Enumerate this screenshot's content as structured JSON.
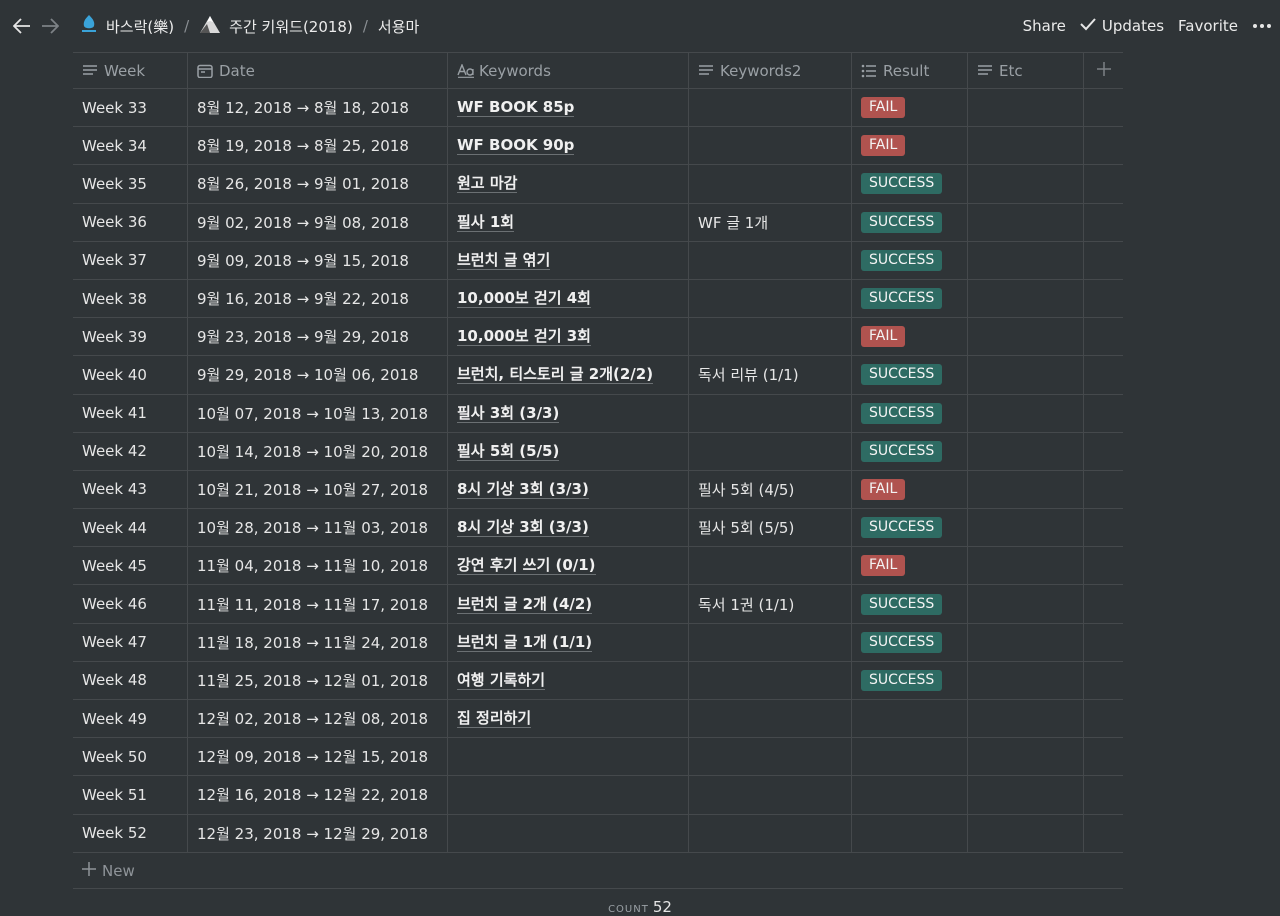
{
  "breadcrumb": [
    "바스락(樂)",
    "주간 키워드(2018)",
    "서용마"
  ],
  "top_actions": {
    "share": "Share",
    "updates": "Updates",
    "favorite": "Favorite"
  },
  "columns": [
    "Week",
    "Date",
    "Keywords",
    "Keywords2",
    "Result",
    "Etc"
  ],
  "column_icons": [
    "text-icon",
    "calendar-icon",
    "title-icon",
    "text-icon",
    "list-icon",
    "text-icon"
  ],
  "rows": [
    {
      "week": "Week 33",
      "date": "8월 12, 2018 → 8월 18, 2018",
      "kw": "WF BOOK 85p",
      "kw2": "",
      "result": "FAIL"
    },
    {
      "week": "Week 34",
      "date": "8월 19, 2018 → 8월 25, 2018",
      "kw": "WF BOOK 90p",
      "kw2": "",
      "result": "FAIL"
    },
    {
      "week": "Week 35",
      "date": "8월 26, 2018 → 9월 01, 2018",
      "kw": "원고 마감",
      "kw2": "",
      "result": "SUCCESS"
    },
    {
      "week": "Week 36",
      "date": "9월 02, 2018 → 9월 08, 2018",
      "kw": "필사 1회",
      "kw2": "WF 글 1개",
      "result": "SUCCESS"
    },
    {
      "week": "Week 37",
      "date": "9월 09, 2018 → 9월 15, 2018",
      "kw": "브런치 글 엮기",
      "kw2": "",
      "result": "SUCCESS"
    },
    {
      "week": "Week 38",
      "date": "9월 16, 2018 → 9월 22, 2018",
      "kw": "10,000보 걷기 4회",
      "kw2": "",
      "result": "SUCCESS"
    },
    {
      "week": "Week 39",
      "date": "9월 23, 2018 → 9월 29, 2018",
      "kw": "10,000보 걷기 3회",
      "kw2": "",
      "result": "FAIL"
    },
    {
      "week": "Week 40",
      "date": "9월 29, 2018 → 10월 06, 2018",
      "kw": "브런치, 티스토리 글 2개(2/2)",
      "kw2": "독서 리뷰 (1/1)",
      "result": "SUCCESS"
    },
    {
      "week": "Week 41",
      "date": "10월 07, 2018 → 10월 13, 2018",
      "kw": "필사 3회 (3/3)",
      "kw2": "",
      "result": "SUCCESS"
    },
    {
      "week": "Week 42",
      "date": "10월 14, 2018 → 10월 20, 2018",
      "kw": "필사 5회 (5/5)",
      "kw2": "",
      "result": "SUCCESS"
    },
    {
      "week": "Week 43",
      "date": "10월 21, 2018 → 10월 27, 2018",
      "kw": "8시 기상 3회 (3/3)",
      "kw2": "필사 5회 (4/5)",
      "result": "FAIL"
    },
    {
      "week": "Week 44",
      "date": "10월 28, 2018 → 11월 03, 2018",
      "kw": "8시 기상 3회 (3/3)",
      "kw2": "필사 5회 (5/5)",
      "result": "SUCCESS"
    },
    {
      "week": "Week 45",
      "date": "11월 04, 2018 → 11월 10, 2018",
      "kw": "강연 후기 쓰기 (0/1)",
      "kw2": "",
      "result": "FAIL"
    },
    {
      "week": "Week 46",
      "date": "11월 11, 2018 → 11월 17, 2018",
      "kw": "브런치 글 2개 (4/2)",
      "kw2": "독서 1권 (1/1)",
      "result": "SUCCESS"
    },
    {
      "week": "Week 47",
      "date": "11월 18, 2018 → 11월 24, 2018",
      "kw": "브런치 글 1개 (1/1)",
      "kw2": "",
      "result": "SUCCESS"
    },
    {
      "week": "Week 48",
      "date": "11월 25, 2018 → 12월 01, 2018",
      "kw": "여행 기록하기",
      "kw2": "",
      "result": "SUCCESS"
    },
    {
      "week": "Week 49",
      "date": "12월 02, 2018 → 12월 08, 2018",
      "kw": "집 정리하기",
      "kw2": "",
      "result": ""
    },
    {
      "week": "Week 50",
      "date": "12월 09, 2018 → 12월 15, 2018",
      "kw": "",
      "kw2": "",
      "result": ""
    },
    {
      "week": "Week 51",
      "date": "12월 16, 2018 → 12월 22, 2018",
      "kw": "",
      "kw2": "",
      "result": ""
    },
    {
      "week": "Week 52",
      "date": "12월 23, 2018 → 12월 29, 2018",
      "kw": "",
      "kw2": "",
      "result": ""
    }
  ],
  "tag_colors": {
    "FAIL": "#b0534f",
    "SUCCESS": "#2e6b63"
  },
  "new_label": "New",
  "count_label": "COUNT",
  "count_value": "52"
}
